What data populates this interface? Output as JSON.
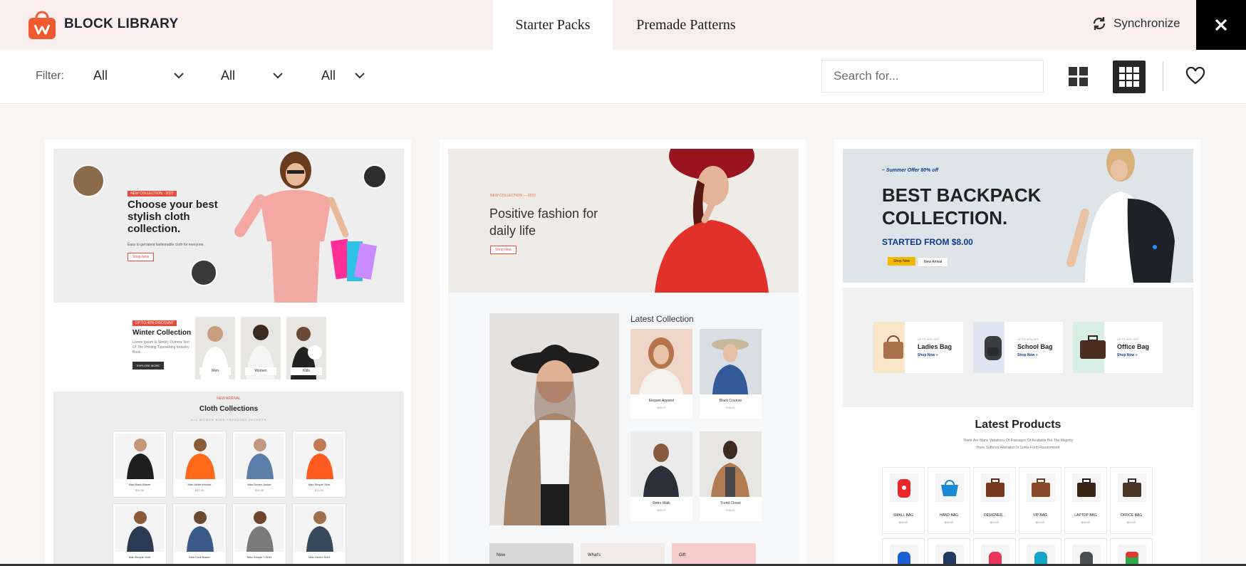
{
  "header": {
    "brand_name": "BLOCK LIBRARY",
    "tabs": [
      {
        "label": "Starter Packs",
        "active": true
      },
      {
        "label": "Premade Patterns",
        "active": false
      }
    ],
    "sync_label": "Synchronize",
    "accent_color": "#f05a30",
    "bg_color": "#fbefee"
  },
  "filters": {
    "label": "Filter:",
    "selects": [
      {
        "value": "All"
      },
      {
        "value": "All"
      },
      {
        "value": "All"
      }
    ],
    "search_placeholder": "Search for..."
  },
  "view": {
    "active_mode": "grid-3"
  },
  "cards": [
    {
      "hero": {
        "tag": "NEW COLLECTION · 2022",
        "title": "Choose your best stylish cloth collection.",
        "sub": "Easy to get latest fashionable cloth for everyone.",
        "button": "Shop Now"
      },
      "winter": {
        "tag": "UP TO 40% DISCOUNT",
        "title": "Winter Collection",
        "sub": "Lorem Ipsum Is Simply Dummy Text Of The Printing Typesetting Industry Book.",
        "button": "EXPLORE MORE",
        "categories": [
          "Men",
          "Women",
          "Kids"
        ]
      },
      "collections": {
        "tag": "NEW ARRIVAL",
        "title": "Cloth Collections",
        "filters": "ALL  WOMEN  KIDS  TRENDING  JACKETS",
        "products": [
          {
            "name": "Man Black Blazer",
            "price": "$21.00"
          },
          {
            "name": "Man White Hoodie",
            "price": "$21.00"
          },
          {
            "name": "Man Denim Jacket",
            "price": "$21.00"
          },
          {
            "name": "Man Simple Shirt",
            "price": "$15.00"
          },
          {
            "name": "Man Simple Shirt",
            "price": ""
          },
          {
            "name": "Man Cool Blazer",
            "price": ""
          },
          {
            "name": "Man Simple T-Shirt",
            "price": ""
          },
          {
            "name": "Man Denim Shirt",
            "price": ""
          }
        ]
      }
    },
    {
      "hero": {
        "tag": "NEW COLLECTION — 2022",
        "title": "Positive fashion for daily life",
        "button": "Shop Now"
      },
      "latest": {
        "title": "Latest Collection",
        "products": [
          {
            "name": "Elegant Apparel",
            "price": "$28.00"
          },
          {
            "name": "Black Couture",
            "price": "$38.00"
          },
          {
            "name": "Retro Walk",
            "price": "$28.00"
          },
          {
            "name": "Trend Closet",
            "price": "$38.00"
          }
        ]
      },
      "strips": [
        "New",
        "What's",
        "Gift"
      ]
    },
    {
      "hero": {
        "tag": "– Summer Offer 80% off",
        "title": "BEST BACKPACK COLLECTION.",
        "from": "STARTED FROM $8.00",
        "btn_primary": "Shop Now",
        "btn_secondary": "New Arrival"
      },
      "categories": [
        {
          "off": "UP TO 50% OFF",
          "name": "Ladies Bag",
          "shop": "Shop Now »"
        },
        {
          "off": "UP TO 50% OFF",
          "name": "School Bag",
          "shop": "Shop Now »"
        },
        {
          "off": "UP TO 50% OFF",
          "name": "Office Bag",
          "shop": "Shop Now »"
        }
      ],
      "latest": {
        "title": "Latest Products",
        "sub1": "There Are Many Variations Of Passages Of Available But The Majority",
        "sub2": "Have Suffered Alteration In Some Form Randomised",
        "products": [
          {
            "name": "SMALL BAG",
            "price": "$28.00"
          },
          {
            "name": "HAND BAG",
            "price": "$28.00"
          },
          {
            "name": "DESIGNER...",
            "price": "$20.00"
          },
          {
            "name": "VIP BAG",
            "price": "$20.00"
          },
          {
            "name": "LAPTOP BAG",
            "price": "$28.00"
          },
          {
            "name": "OFFICE BAG",
            "price": "$20.00"
          }
        ]
      }
    }
  ]
}
